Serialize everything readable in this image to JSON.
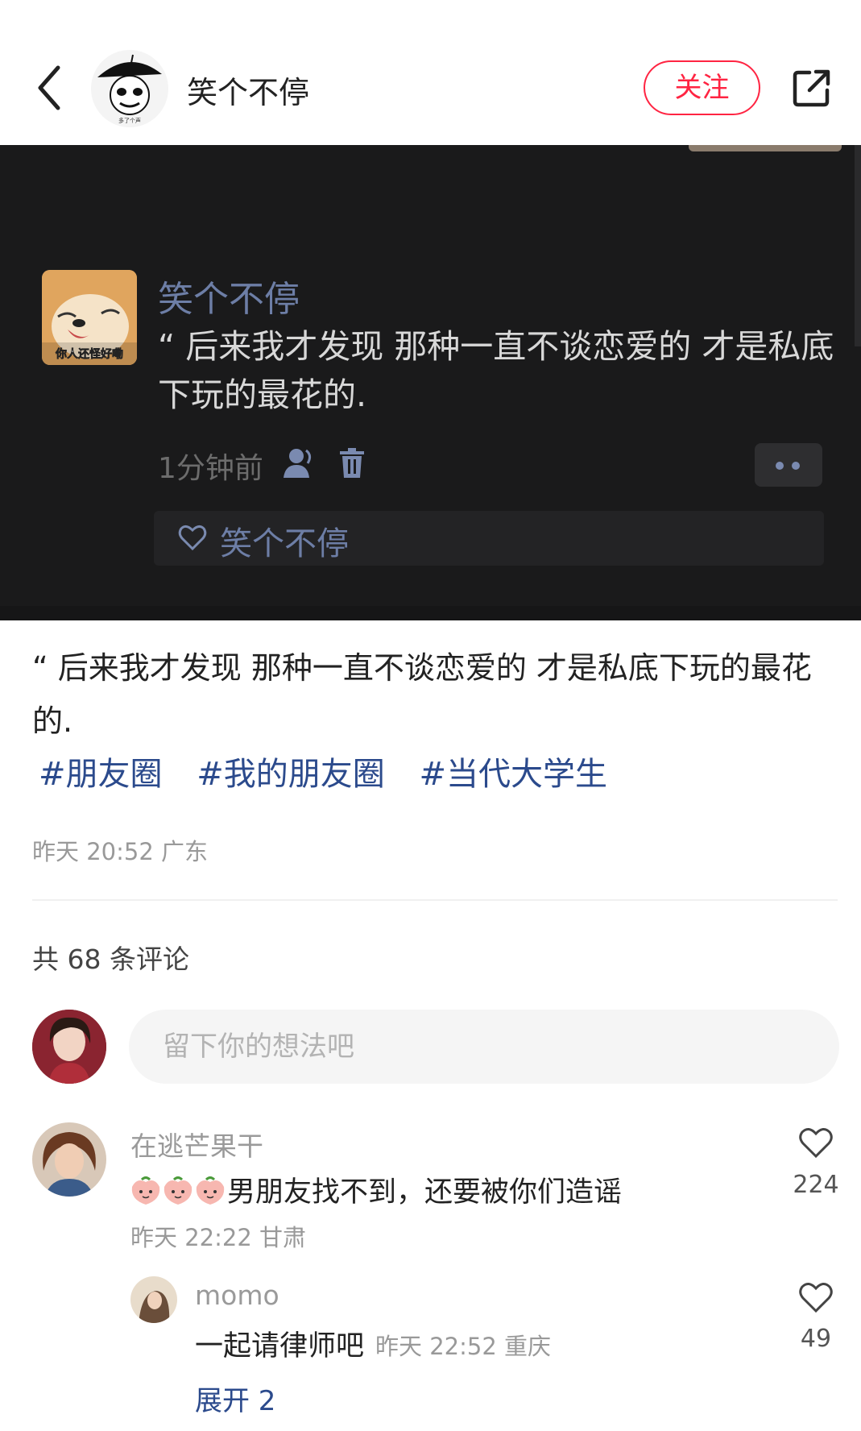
{
  "header": {
    "author_name": "笑个不停",
    "follow_label": "关注"
  },
  "image": {
    "author_name": "笑个不停",
    "avatar_caption": "你人还怪好嘞",
    "quote": "“ 后来我才发现 那种一直不谈恋爱的 才是私底下玩的最花的.",
    "time_ago": "1分钟前",
    "liked_by": "笑个不停"
  },
  "post": {
    "text": "“ 后来我才发现 那种一直不谈恋爱的 才是私底下玩的最花的.",
    "tags": [
      "#朋友圈",
      "#我的朋友圈",
      "#当代大学生"
    ],
    "meta": "昨天 20:52 广东"
  },
  "comments_header": {
    "count_label": "共 68 条评论"
  },
  "comment_input": {
    "placeholder": "留下你的想法吧"
  },
  "comments": [
    {
      "user": "在逃芒果干",
      "text": "男朋友找不到，还要被你们造谣",
      "meta": "昨天 22:22 甘肃",
      "likes": "224",
      "emoji": "peach-emoji"
    },
    {
      "user": "momo",
      "text": "一起请律师吧",
      "meta": "昨天 22:52 重庆",
      "likes": "49"
    }
  ],
  "expand_label": "展开 2",
  "colors": {
    "accent": "#ff2442",
    "link": "#2b4a8c",
    "dark_bg": "#1a1a1b"
  }
}
